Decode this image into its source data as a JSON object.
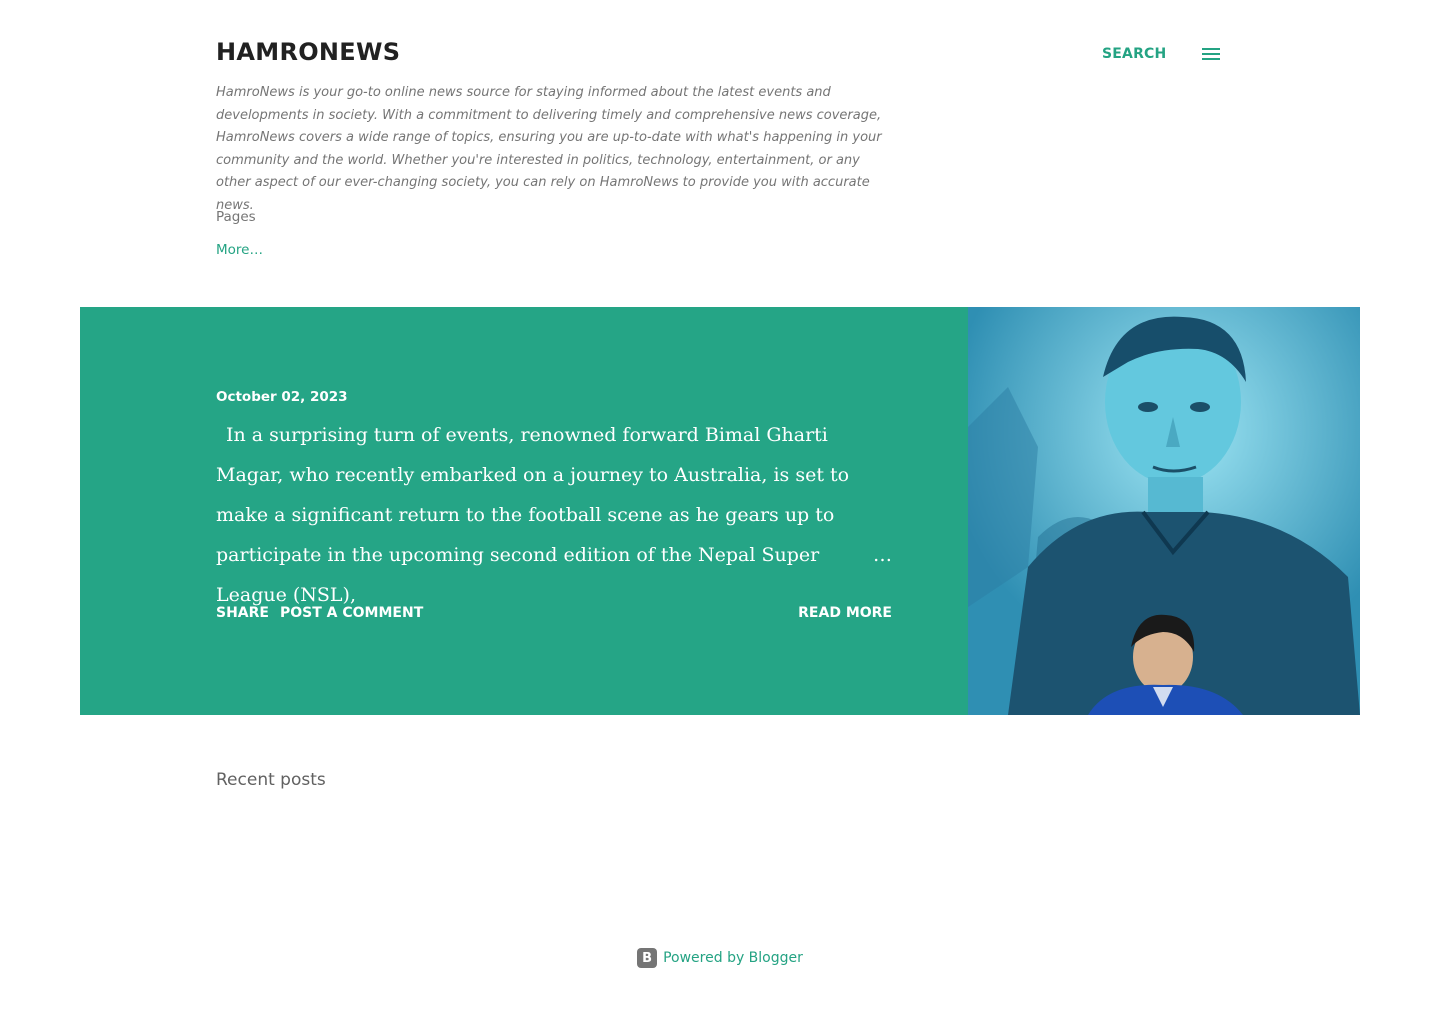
{
  "header": {
    "title": "HamroNews",
    "search_label": "Search",
    "menu_icon": "menu-icon"
  },
  "description": "HamroNews is your go-to online news source for staying informed about the latest events and developments in society. With a commitment to delivering timely and comprehensive news coverage, HamroNews covers a wide range of topics, ensuring you are up-to-date with what's happening in your community and the world. Whether you're interested in politics, technology, entertainment, or any other aspect of our ever-changing society, you can rely on HamroNews to provide you with accurate news.",
  "pages": {
    "label": "Pages",
    "more_label": "More…"
  },
  "featured_post": {
    "date": "October 02, 2023",
    "snippet": "In a surprising turn of events, renowned forward Bimal Gharti Magar, who recently embarked on a journey to Australia, is set to make a significant return to the football scene as he gears up to participate in the upcoming second edition of the Nepal Super League (NSL),",
    "ellipsis": "…",
    "share_label": "Share",
    "comment_label": "Post a Comment",
    "read_more_label": "Read more",
    "accent_color": "#25a586"
  },
  "recent_posts_label": "Recent posts",
  "footer": {
    "powered_by": "Powered by Blogger",
    "icon": "blogger-icon"
  }
}
